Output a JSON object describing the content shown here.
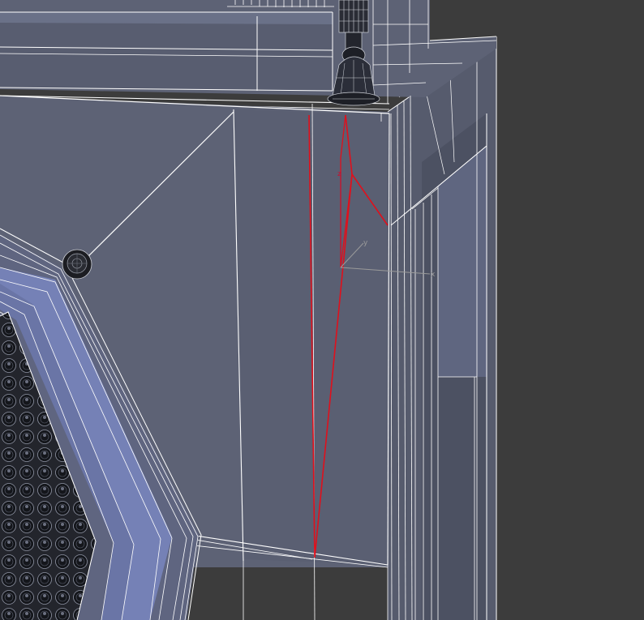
{
  "viewport": {
    "background_color": "#3c3c3c",
    "mesh_fill_color": "#5d6275",
    "mesh_dark_fill_color": "#4f5466",
    "mesh_bevel_color": "#7481b8",
    "wire_color": "#ffffff",
    "selection_color": "#e0101c",
    "perforated_panel_color": "#23252c"
  },
  "gizmo": {
    "z_label": "z",
    "y_label": "y",
    "x_label": "x",
    "z_color": "#c8102e",
    "xy_color": "#9a9a9a"
  },
  "icons": {
    "rivet": "bolt-head-icon",
    "antenna": "antenna-mount-icon",
    "gizmo": "transform-gizmo-icon"
  }
}
